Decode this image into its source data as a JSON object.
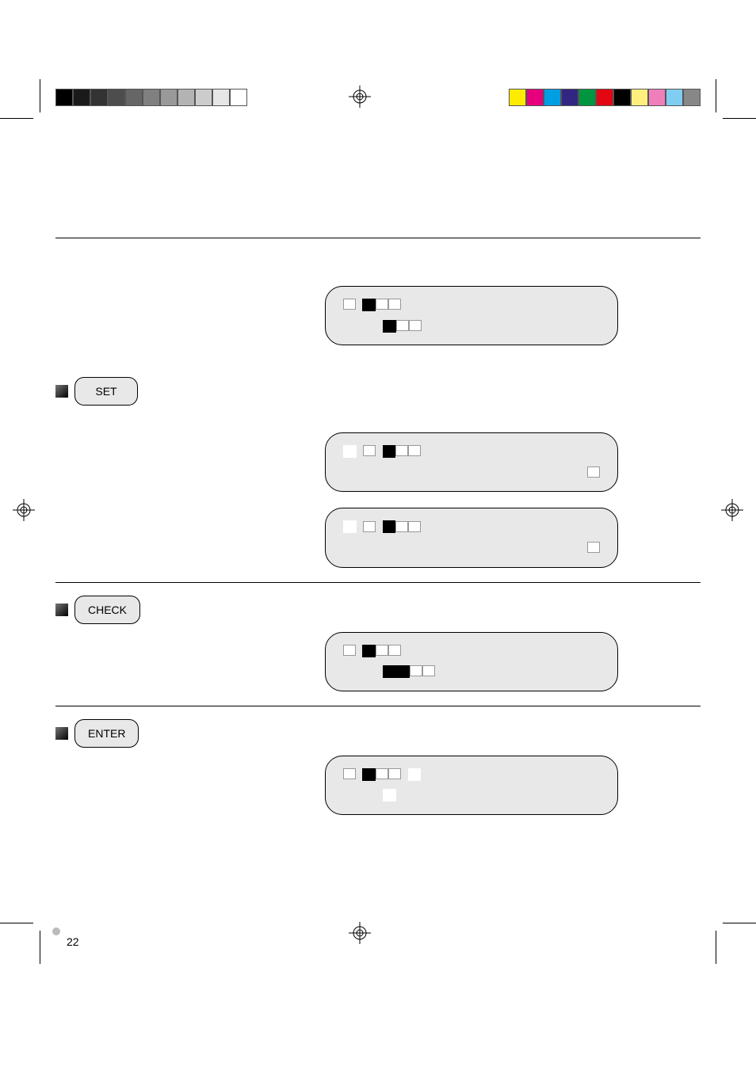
{
  "page": {
    "num": "22"
  },
  "step1": {
    "text": ""
  },
  "lcd1": {
    "line1a": "",
    "line2": ""
  },
  "step2": {
    "button": "SET",
    "label": "",
    "texta": "",
    "textb": ""
  },
  "lcd2": {
    "line1a": "",
    "line2a": "",
    "line2b": ""
  },
  "lcd3": {
    "line2a": "",
    "line2b": ""
  },
  "step3": {
    "button": "CHECK",
    "label": "",
    "text": ""
  },
  "lcd4": {
    "line1a": "",
    "line2": ""
  },
  "step4": {
    "button": "ENTER",
    "label": "",
    "text": ""
  },
  "lcd5": {
    "line1a": "",
    "line2": ""
  }
}
